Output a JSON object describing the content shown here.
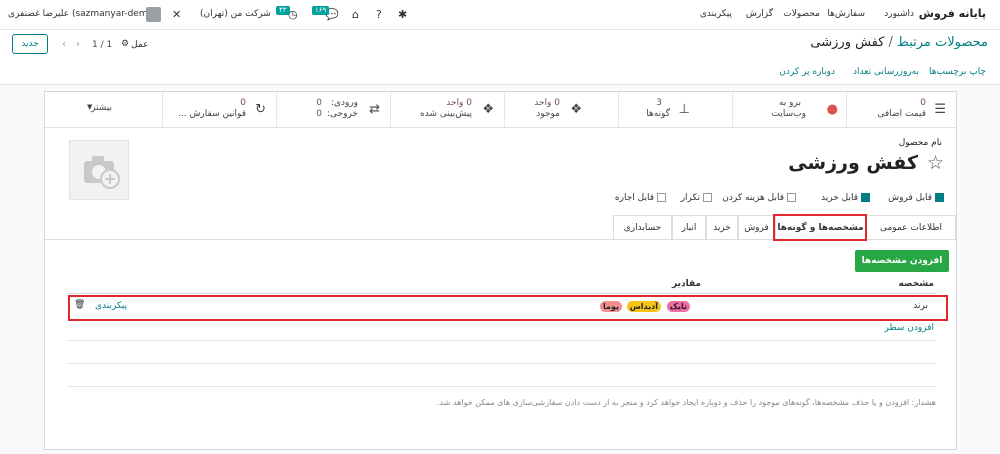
{
  "navbar": {
    "app_name": "پایانه فروش",
    "menu": [
      "داشبورد",
      "سفارش‌ها",
      "محصولات",
      "گزارش",
      "پیکربندی"
    ],
    "company": "شرکت من (تهران)",
    "user": "علیرضا غضنفری (sazmanyar-demo)",
    "messages_badge": "۱۶۹",
    "activity_badge": "۴۳"
  },
  "control": {
    "breadcrumb_parent": "محصولات مرتبط",
    "breadcrumb_current": "کفش ورزشی",
    "pager": "1 / 1",
    "action_label": "عمل",
    "new_button": "جدید"
  },
  "actions": [
    "چاپ برچسب‌ها",
    "به‌روزرسانی تعداد",
    "دوباره پر کردن"
  ],
  "smart_buttons": {
    "extra_price": {
      "value": "0",
      "label": "قیمت اضافی"
    },
    "website": {
      "value": "برو به",
      "label": "وب‌سایت"
    },
    "variants": {
      "value": "3",
      "label": "گونه‌ها"
    },
    "on_hand": {
      "value": "0 واحد",
      "label": "موجود"
    },
    "forecasted": {
      "value": "0 واحد",
      "label": "پیش‌بینی شده"
    },
    "in_out": {
      "in_label": "ورودی:",
      "in_value": "0",
      "out_label": "خروجی:",
      "out_value": "0"
    },
    "reorder": {
      "value": "0",
      "label": "قوانین سفارش ..."
    },
    "more": "بیشتر"
  },
  "product": {
    "name_label": "نام محصول",
    "name": "کفش ورزشی"
  },
  "checkboxes": [
    {
      "label": "قابل فروش",
      "checked": true
    },
    {
      "label": "قابل خرید",
      "checked": true
    },
    {
      "label": "قابل هزینه کردن",
      "checked": false
    },
    {
      "label": "تکرار",
      "checked": false
    },
    {
      "label": "قابل اجاره",
      "checked": false
    }
  ],
  "tabs": [
    "اطلاعات عمومی",
    "مشخصه‌ها و گونه‌ها",
    "فروش",
    "خرید",
    "انبار",
    "حسابداری"
  ],
  "active_tab": "مشخصه‌ها و گونه‌ها",
  "attributes_tab": {
    "add_button": "افزودن مشخصه‌ها",
    "col_attribute": "مشخصه",
    "col_values": "مقادیر",
    "row": {
      "attribute": "برند",
      "values": [
        {
          "label": "نایک",
          "color": "#f06aa4"
        },
        {
          "label": "آدیداس",
          "color": "#f5c518"
        },
        {
          "label": "پوما",
          "color": "#ef8f8f"
        }
      ],
      "config_link": "پیکربندی"
    },
    "add_line": "افزودن سطر",
    "warning": "هشدار: افزودن و یا حذف مشخصه‌ها، گونه‌های موجود را حذف و دوباره ایجاد خواهد کرد و منجر به از دست دادن سفارشی‌سازی های ممکن خواهد شد."
  },
  "colors": {
    "primary": "#017e84",
    "accent": "#714b67",
    "success": "#28a745",
    "highlight": "#e3262a"
  }
}
